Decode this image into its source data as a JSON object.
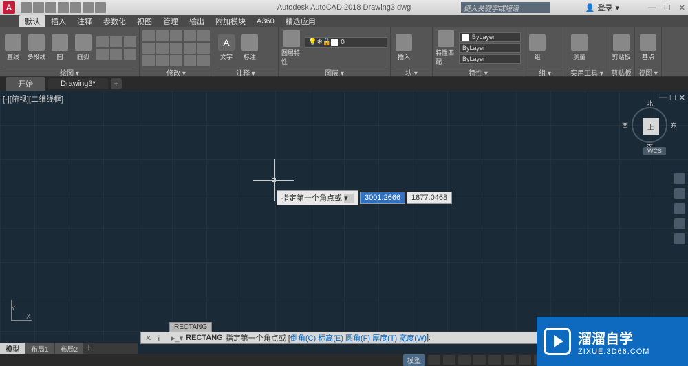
{
  "titlebar": {
    "app_name": "Autodesk AutoCAD 2018",
    "document": "Drawing3.dwg",
    "full_title": "Autodesk AutoCAD 2018   Drawing3.dwg",
    "search_placeholder": "键入关键字或短语",
    "login_label": "登录",
    "logo_letter": "A"
  },
  "menubar": {
    "items": [
      "默认",
      "插入",
      "注释",
      "参数化",
      "视图",
      "管理",
      "输出",
      "附加模块",
      "A360",
      "精选应用"
    ],
    "active_index": 0
  },
  "ribbon": {
    "panels": [
      {
        "label": "绘图 ▾",
        "buttons": [
          "直线",
          "多段线",
          "圆",
          "圆弧"
        ]
      },
      {
        "label": "修改 ▾",
        "buttons": []
      },
      {
        "label": "注释 ▾",
        "buttons": [
          "文字",
          "标注"
        ]
      },
      {
        "label": "图层 ▾",
        "buttons": [
          "图层特性"
        ],
        "layer_select": {
          "color": "#ffffff",
          "value": "0"
        }
      },
      {
        "label": "块 ▾",
        "buttons": [
          "插入"
        ]
      },
      {
        "label": "特性 ▾",
        "buttons": [
          "特性匹配"
        ],
        "props": [
          "ByLayer",
          "ByLayer",
          "ByLayer"
        ]
      },
      {
        "label": "组 ▾",
        "buttons": [
          "组"
        ]
      },
      {
        "label": "实用工具 ▾",
        "buttons": [
          "测量"
        ]
      },
      {
        "label": "剪贴板",
        "buttons": [
          "剪贴板"
        ]
      },
      {
        "label": "视图 ▾",
        "buttons": [
          "基点"
        ]
      }
    ]
  },
  "filetabs": {
    "tabs": [
      {
        "label": "开始",
        "dirty": false
      },
      {
        "label": "Drawing3",
        "dirty": true
      }
    ],
    "active_index": 1
  },
  "viewport": {
    "label": "[-][俯视][二维线框]",
    "viewcube": {
      "face": "上",
      "n": "北",
      "s": "南",
      "e": "东",
      "w": "西",
      "cs": "WCS"
    }
  },
  "dynamic_input": {
    "prompt": "指定第一个角点或",
    "coord_x": "3001.2666",
    "coord_y": "1877.0468"
  },
  "ucs": {
    "x": "X",
    "y": "Y"
  },
  "command": {
    "active_cmd_label": "RECTANG",
    "name": "RECTANG",
    "prompt": "指定第一个角点或 [",
    "options": [
      {
        "key": "C",
        "label": "倒角"
      },
      {
        "key": "E",
        "label": "标高"
      },
      {
        "key": "F",
        "label": "圆角"
      },
      {
        "key": "T",
        "label": "厚度"
      },
      {
        "key": "W",
        "label": "宽度"
      }
    ],
    "suffix": "]:"
  },
  "layout": {
    "tabs": [
      "模型",
      "布局1",
      "布局2"
    ],
    "active_index": 0
  },
  "statusbar": {
    "model_label": "模型"
  },
  "watermark": {
    "title": "溜溜自学",
    "url": "ZIXUE.3D66.COM"
  }
}
